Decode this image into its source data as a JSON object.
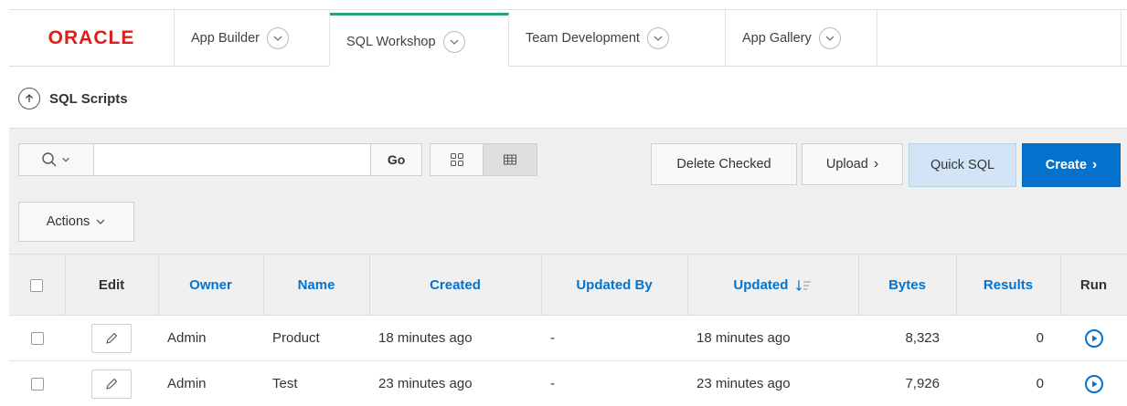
{
  "nav": {
    "logo": "ORACLE",
    "tabs": [
      {
        "label": "App Builder"
      },
      {
        "label": "SQL Workshop"
      },
      {
        "label": "Team Development"
      },
      {
        "label": "App Gallery"
      }
    ]
  },
  "breadcrumb": {
    "title": "SQL Scripts"
  },
  "toolbar": {
    "search_value": "",
    "go_label": "Go",
    "delete_checked_label": "Delete Checked",
    "upload_label": "Upload",
    "quick_sql_label": "Quick SQL",
    "create_label": "Create",
    "actions_label": "Actions"
  },
  "table": {
    "columns": {
      "edit": "Edit",
      "owner": "Owner",
      "name": "Name",
      "created": "Created",
      "updated_by": "Updated By",
      "updated": "Updated",
      "bytes": "Bytes",
      "results": "Results",
      "run": "Run"
    },
    "rows": [
      {
        "owner": "Admin",
        "name": "Product",
        "created": "18 minutes ago",
        "updated_by": "-",
        "updated": "18 minutes ago",
        "bytes": "8,323",
        "results": "0"
      },
      {
        "owner": "Admin",
        "name": "Test",
        "created": "23 minutes ago",
        "updated_by": "-",
        "updated": "23 minutes ago",
        "bytes": "7,926",
        "results": "0"
      }
    ]
  },
  "colors": {
    "accent": "#0572ce",
    "active_tab": "#26a46e",
    "logo": "#e21b1b"
  }
}
